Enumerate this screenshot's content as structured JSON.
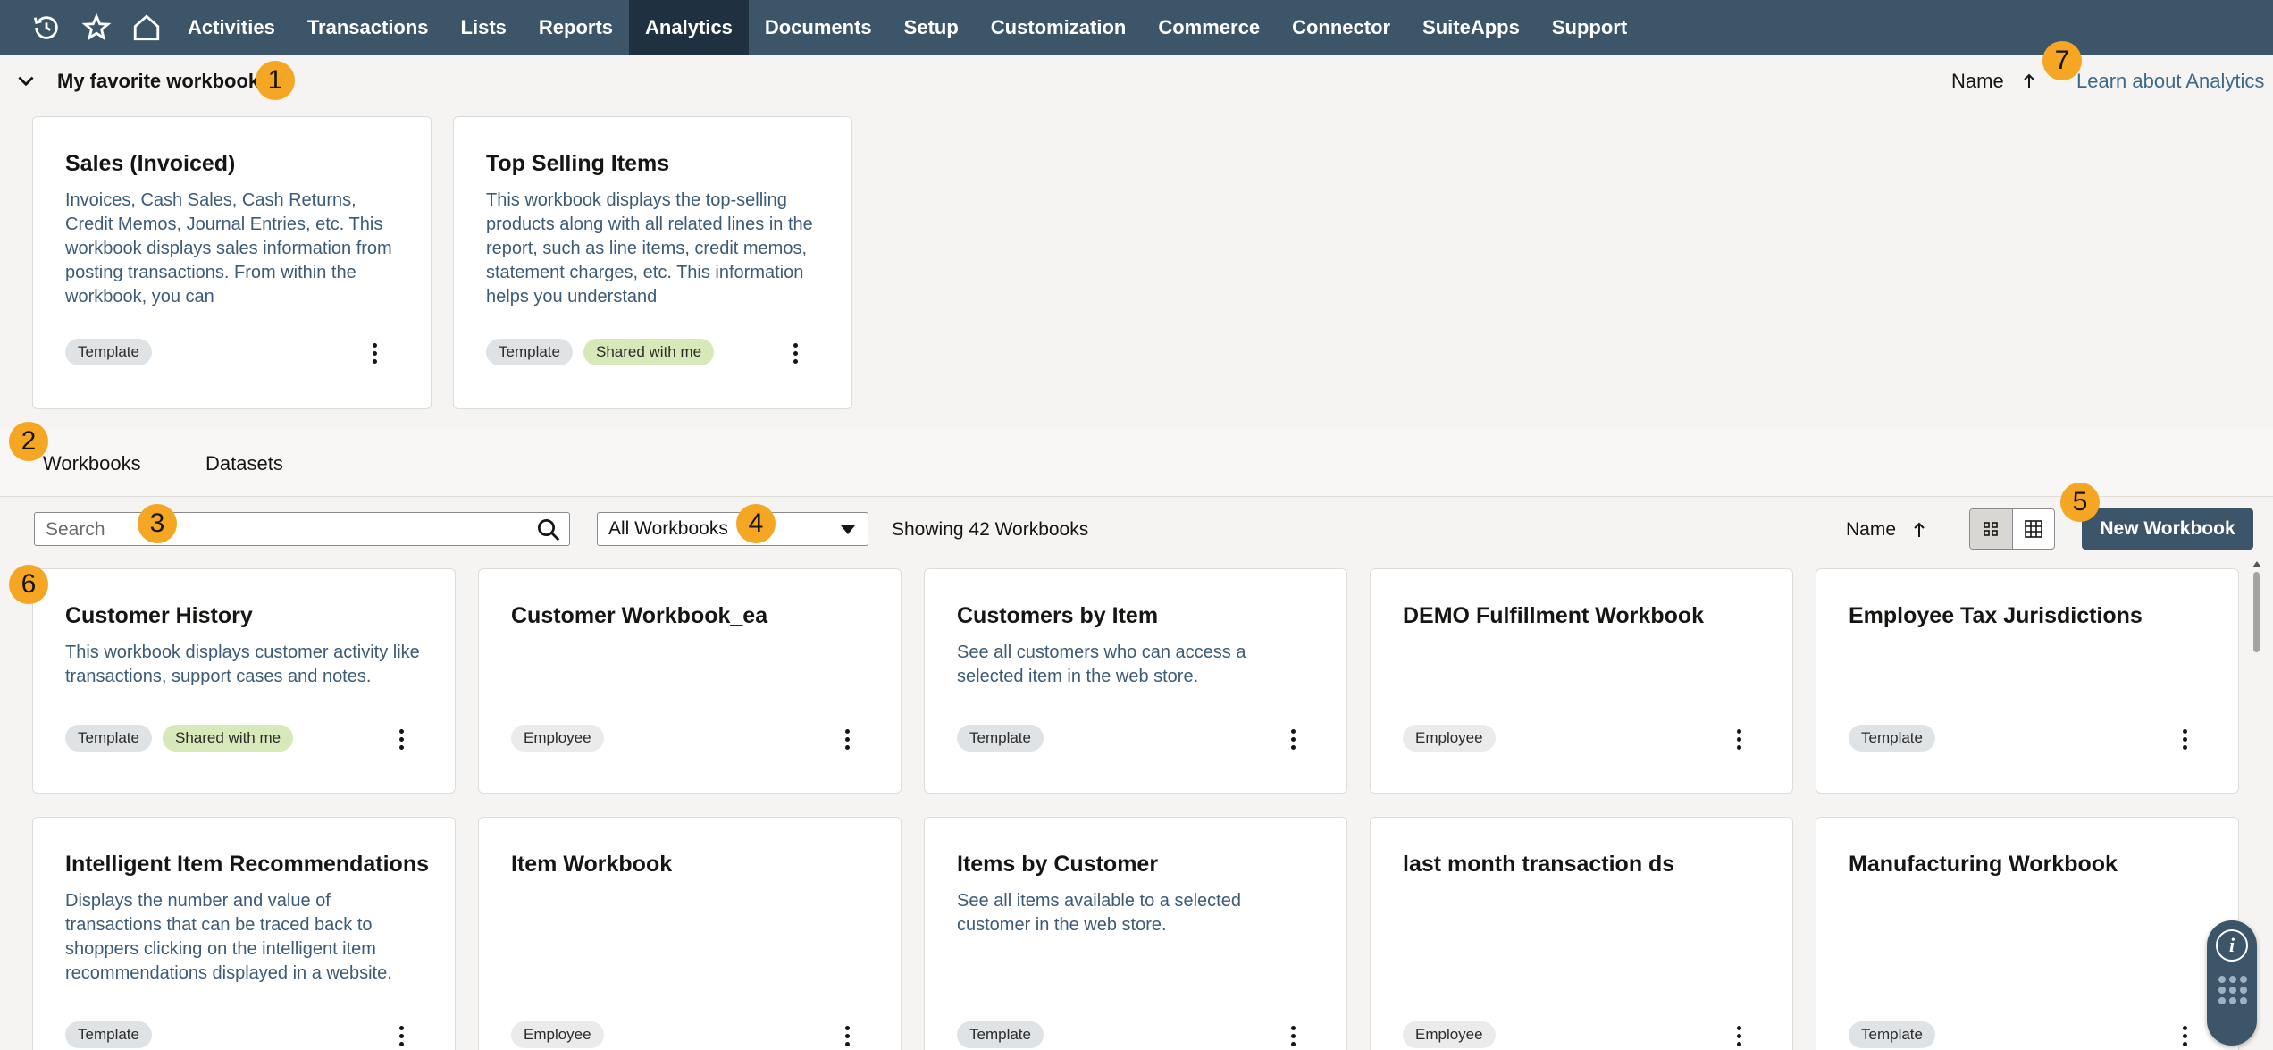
{
  "nav": {
    "items": [
      "Activities",
      "Transactions",
      "Lists",
      "Reports",
      "Analytics",
      "Documents",
      "Setup",
      "Customization",
      "Commerce",
      "Connector",
      "SuiteApps",
      "Support"
    ],
    "active": "Analytics"
  },
  "favorites": {
    "title": "My favorite workbooks",
    "sort_label": "Name",
    "learn_link": "Learn about Analytics",
    "cards": [
      {
        "title": "Sales (Invoiced)",
        "description": "Invoices, Cash Sales, Cash Returns, Credit Memos, Journal Entries, etc. This workbook displays sales information from posting transactions. From within the workbook, you can",
        "tags": [
          "Template"
        ]
      },
      {
        "title": "Top Selling Items",
        "description": "This workbook displays the top-selling products along with all related lines in the report, such as line items, credit memos, statement charges, etc. This information helps you understand",
        "tags": [
          "Template",
          "Shared with me"
        ]
      }
    ]
  },
  "tabs": {
    "workbooks": "Workbooks",
    "datasets": "Datasets"
  },
  "toolbar": {
    "search_placeholder": "Search",
    "filter_value": "All Workbooks",
    "showing": "Showing 42 Workbooks",
    "sort_label": "Name",
    "new_workbook": "New Workbook"
  },
  "workbooks": [
    {
      "title": "Customer History",
      "description": "This workbook displays customer activity like transactions, support cases and notes.",
      "tags": [
        "Template",
        "Shared with me"
      ]
    },
    {
      "title": "Customer Workbook_ea",
      "description": "",
      "tags": [
        "Employee"
      ]
    },
    {
      "title": "Customers by Item",
      "description": "See all customers who can access a selected item in the web store.",
      "tags": [
        "Template"
      ]
    },
    {
      "title": "DEMO Fulfillment Workbook",
      "description": "",
      "tags": [
        "Employee"
      ]
    },
    {
      "title": "Employee Tax Jurisdictions",
      "description": "",
      "tags": [
        "Template"
      ]
    },
    {
      "title": "Intelligent Item Recommendations",
      "description": "Displays the number and value of transactions that can be traced back to shoppers clicking on the intelligent item recommendations displayed in a website.",
      "tags": [
        "Template"
      ]
    },
    {
      "title": "Item Workbook",
      "description": "",
      "tags": [
        "Employee"
      ]
    },
    {
      "title": "Items by Customer",
      "description": "See all items available to a selected customer in the web store.",
      "tags": [
        "Template"
      ]
    },
    {
      "title": "last month transaction ds",
      "description": "",
      "tags": [
        "Employee"
      ]
    },
    {
      "title": "Manufacturing Workbook",
      "description": "",
      "tags": [
        "Template"
      ]
    }
  ],
  "markers": [
    "1",
    "2",
    "3",
    "4",
    "5",
    "6",
    "7"
  ],
  "colors": {
    "nav_bg": "#3d5568",
    "nav_active": "#1f3140",
    "marker": "#f5a623",
    "tag_shared": "#d7e8b9",
    "desc_text": "#3b5b77"
  }
}
